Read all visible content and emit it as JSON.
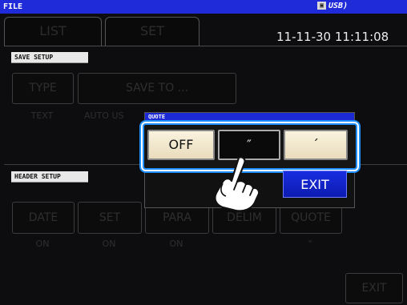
{
  "title_bar": {
    "title": "FILE",
    "usb_icon": "drive-icon",
    "usb_label": "USB"
  },
  "tabs": [
    {
      "label": "LIST"
    },
    {
      "label": "SET"
    }
  ],
  "datetime": "11-11-30 11:11:08",
  "save_setup": {
    "header": "SAVE SETUP",
    "type_button": "TYPE",
    "save_to_button": "SAVE TO ...",
    "type_value": "TEXT",
    "save_to_value": "AUTO US"
  },
  "header_setup": {
    "header": "HEADER SETUP",
    "items": [
      {
        "label": "DATE",
        "value": "ON"
      },
      {
        "label": "SET",
        "value": "ON"
      },
      {
        "label": "PARA",
        "value": "ON"
      },
      {
        "label": "DELIM",
        "value": ""
      },
      {
        "label": "QUOTE",
        "value": "\""
      }
    ]
  },
  "quote_dialog": {
    "title": "QUOTE",
    "options": [
      {
        "label": "OFF"
      },
      {
        "label": "″"
      },
      {
        "label": "´"
      }
    ],
    "exit": "EXIT"
  },
  "bottom_exit": "EXIT",
  "icons": {
    "pointer": "pointing-hand-icon"
  },
  "colors": {
    "title_blue": "#1f2bd8",
    "highlight_blue": "#1e90ff",
    "option_cream": "#f4ead0"
  }
}
